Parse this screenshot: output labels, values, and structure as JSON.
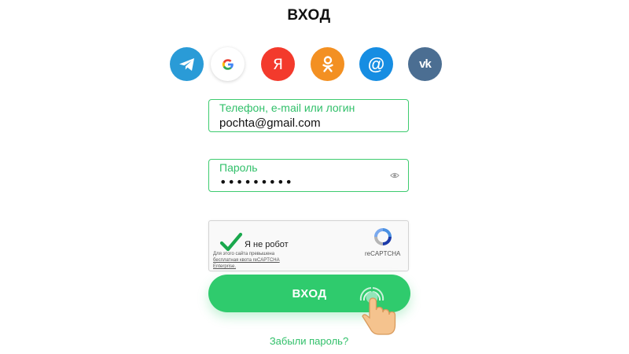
{
  "page": {
    "title": "ВХОД"
  },
  "socials": {
    "yandex_glyph": "Я",
    "mail_glyph": "@",
    "vk_glyph": "vk",
    "colors": {
      "telegram": "#2a9bd7",
      "yandex": "#f33a2c",
      "ok": "#f39022",
      "mail": "#168de2",
      "vk": "#4b6e92"
    }
  },
  "login_field": {
    "label": "Телефон, e-mail или логин",
    "value": "pochta@gmail.com"
  },
  "password_field": {
    "label": "Пароль",
    "value": "•••••••••"
  },
  "captcha": {
    "label": "Я не робот",
    "brand": "reCAPTCHA",
    "note_line1": "Для этого сайта превышена",
    "note_link": "бесплатная квота reCAPTCHA",
    "note_line3": "Enterprise."
  },
  "login_button": {
    "label": "ВХОД"
  },
  "forgot_link": {
    "label": "Забыли пароль?"
  },
  "colors": {
    "accent": "#2fcb6d",
    "field_border": "#3ecb6f"
  }
}
